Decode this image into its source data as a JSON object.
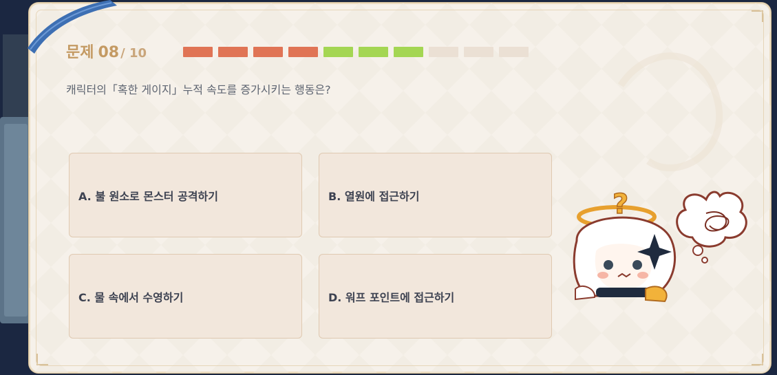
{
  "quiz": {
    "title": "문제",
    "current": "08",
    "total": "/ 10",
    "progress": [
      "wrong",
      "wrong",
      "wrong",
      "wrong",
      "right",
      "right",
      "right",
      "pending",
      "pending",
      "pending"
    ],
    "question": "캐릭터의「혹한 게이지」누적 속도를 증가시키는 행동은?",
    "options": [
      {
        "label": "A. 불 원소로 몬스터 공격하기"
      },
      {
        "label": "B. 열원에 접근하기"
      },
      {
        "label": "C. 물 속에서 수영하기"
      },
      {
        "label": "D. 워프 포인트에 접근하기"
      }
    ]
  },
  "colors": {
    "wrong": "#e07455",
    "right": "#a4d653",
    "pending": "#ebe0d4",
    "accent": "#c49a63"
  }
}
